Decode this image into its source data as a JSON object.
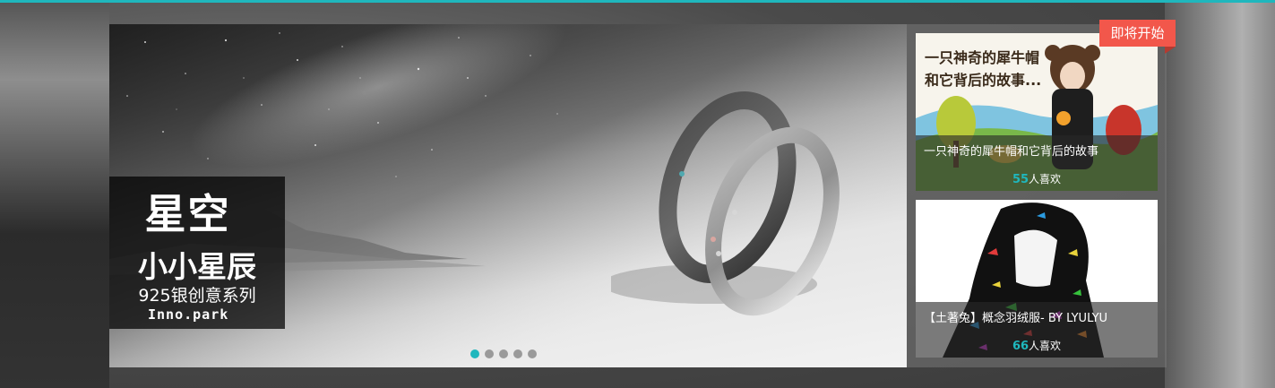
{
  "hero": {
    "title": "星空",
    "subtitle": "小小星辰",
    "series": "925银创意系列",
    "brand": "Inno.park"
  },
  "carousel": {
    "slide_count": 5,
    "active_index": 0
  },
  "badge": {
    "label": "即将开始"
  },
  "cards": [
    {
      "art_text_line1": "一只神奇的犀牛帽",
      "art_text_line2": "和它背后的故事...",
      "title": "一只神奇的犀牛帽和它背后的故事",
      "likes": "55",
      "likes_suffix": "人喜欢"
    },
    {
      "title": "【土著兔】概念羽绒服- BY LYULYU",
      "likes": "66",
      "likes_suffix": "人喜欢"
    }
  ],
  "colors": {
    "accent": "#1fb7bd",
    "badge": "#f2574b"
  }
}
